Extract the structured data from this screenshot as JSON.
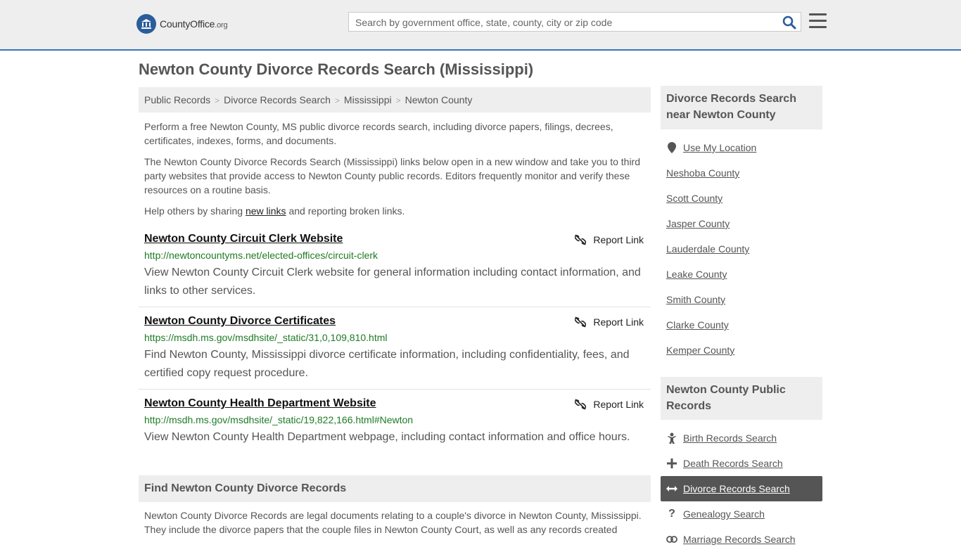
{
  "header": {
    "logo_text_main": "CountyOffice",
    "logo_text_suffix": ".org",
    "search_placeholder": "Search by government office, state, county, city or zip code"
  },
  "main": {
    "title": "Newton County Divorce Records Search (Mississippi)",
    "breadcrumb": [
      "Public Records",
      "Divorce Records Search",
      "Mississippi",
      "Newton County"
    ],
    "intro1": "Perform a free Newton County, MS public divorce records search, including divorce papers, filings, decrees, certificates, indexes, forms, and documents.",
    "intro2": "The Newton County Divorce Records Search (Mississippi) links below open in a new window and take you to third party websites that provide access to Newton County public records. Editors frequently monitor and verify these resources on a routine basis.",
    "intro3_before": "Help others by sharing ",
    "intro3_link": "new links",
    "intro3_after": " and reporting broken links.",
    "report_label": "Report Link",
    "links": [
      {
        "title": "Newton County Circuit Clerk Website",
        "url": "http://newtoncountyms.net/elected-offices/circuit-clerk",
        "desc": "View Newton County Circuit Clerk website for general information including contact information, and links to other services."
      },
      {
        "title": "Newton County Divorce Certificates",
        "url": "https://msdh.ms.gov/msdhsite/_static/31,0,109,810.html",
        "desc": "Find Newton County, Mississippi divorce certificate information, including confidentiality, fees, and certified copy request procedure."
      },
      {
        "title": "Newton County Health Department Website",
        "url": "http://msdh.ms.gov/msdhsite/_static/19,822,166.html#Newton",
        "desc": "View Newton County Health Department webpage, including contact information and office hours."
      }
    ],
    "section_title": "Find Newton County Divorce Records",
    "section_text": "Newton County Divorce Records are legal documents relating to a couple's divorce in Newton County, Mississippi. They include the divorce papers that the couple files in Newton County Court, as well as any records created"
  },
  "sidebar": {
    "nearby_title": "Divorce Records Search near Newton County",
    "use_location": "Use My Location",
    "nearby": [
      "Neshoba County",
      "Scott County",
      "Jasper County",
      "Lauderdale County",
      "Leake County",
      "Smith County",
      "Clarke County",
      "Kemper County"
    ],
    "public_title": "Newton County Public Records",
    "public_records": [
      {
        "label": "Birth Records Search",
        "icon": "baby-icon"
      },
      {
        "label": "Death Records Search",
        "icon": "cross-icon"
      },
      {
        "label": "Divorce Records Search",
        "icon": "arrows-icon"
      },
      {
        "label": "Genealogy Search",
        "icon": "question-icon"
      },
      {
        "label": "Marriage Records Search",
        "icon": "rings-icon"
      }
    ]
  },
  "colors": {
    "accent_blue": "#3a76b8",
    "url_green": "#1e7b25",
    "active_bg": "#555555"
  }
}
